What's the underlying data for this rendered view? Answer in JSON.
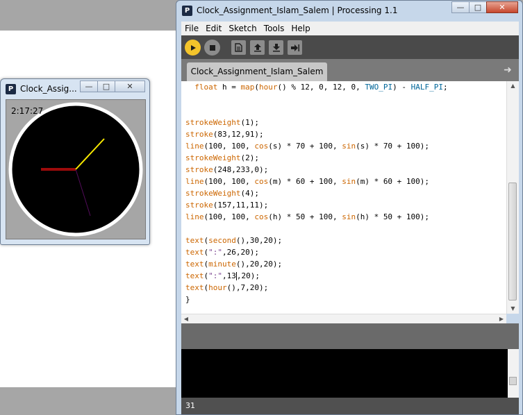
{
  "sketch_window": {
    "title": "Clock_Assig...",
    "time_text": "2:17:27",
    "logo": "P",
    "buttons": [
      "minimize",
      "maximize",
      "close"
    ]
  },
  "clock": {
    "colors": {
      "background": "#a6a6a6",
      "face": "#000000",
      "rim": "#ffffff",
      "second_hand": "#530c5b",
      "minute_hand": "#f8e900",
      "hour_hand": "#9d0b0b"
    }
  },
  "ide": {
    "title": "Clock_Assignment_Islam_Salem | Processing 1.1",
    "logo": "P",
    "menu": [
      "File",
      "Edit",
      "Sketch",
      "Tools",
      "Help"
    ],
    "toolbar": {
      "buttons": [
        "run-icon",
        "stop-icon",
        "new-icon",
        "open-icon",
        "save-icon",
        "export-icon"
      ],
      "run_color": "#f3c42b"
    },
    "tab_label": "Clock_Assignment_Islam_Salem",
    "status_line": "31"
  },
  "code": [
    {
      "segs": [
        {
          "t": "  "
        },
        {
          "t": "float",
          "c": "kw"
        },
        {
          "t": " h = "
        },
        {
          "t": "map",
          "c": "kw"
        },
        {
          "t": "("
        },
        {
          "t": "hour",
          "c": "kw"
        },
        {
          "t": "() % 12, 0, 12, 0, "
        },
        {
          "t": "TWO_PI",
          "c": "const"
        },
        {
          "t": ") - "
        },
        {
          "t": "HALF_PI",
          "c": "const"
        },
        {
          "t": ";"
        }
      ]
    },
    {
      "segs": []
    },
    {
      "segs": []
    },
    {
      "segs": [
        {
          "t": "strokeWeight",
          "c": "kw"
        },
        {
          "t": "(1);"
        }
      ]
    },
    {
      "segs": [
        {
          "t": "stroke",
          "c": "kw"
        },
        {
          "t": "(83,12,91);"
        }
      ]
    },
    {
      "segs": [
        {
          "t": "line",
          "c": "kw"
        },
        {
          "t": "(100, 100, "
        },
        {
          "t": "cos",
          "c": "kw"
        },
        {
          "t": "(s) * 70 + 100, "
        },
        {
          "t": "sin",
          "c": "kw"
        },
        {
          "t": "(s) * 70 + 100);"
        }
      ]
    },
    {
      "segs": [
        {
          "t": "strokeWeight",
          "c": "kw"
        },
        {
          "t": "(2);"
        }
      ]
    },
    {
      "segs": [
        {
          "t": "stroke",
          "c": "kw"
        },
        {
          "t": "(248,233,0);"
        }
      ]
    },
    {
      "segs": [
        {
          "t": "line",
          "c": "kw"
        },
        {
          "t": "(100, 100, "
        },
        {
          "t": "cos",
          "c": "kw"
        },
        {
          "t": "(m) * 60 + 100, "
        },
        {
          "t": "sin",
          "c": "kw"
        },
        {
          "t": "(m) * 60 + 100);"
        }
      ]
    },
    {
      "segs": [
        {
          "t": "strokeWeight",
          "c": "kw"
        },
        {
          "t": "(4);"
        }
      ]
    },
    {
      "segs": [
        {
          "t": "stroke",
          "c": "kw"
        },
        {
          "t": "(157,11,11);"
        }
      ]
    },
    {
      "segs": [
        {
          "t": "line",
          "c": "kw"
        },
        {
          "t": "(100, 100, "
        },
        {
          "t": "cos",
          "c": "kw"
        },
        {
          "t": "(h) * 50 + 100, "
        },
        {
          "t": "sin",
          "c": "kw"
        },
        {
          "t": "(h) * 50 + 100);"
        }
      ]
    },
    {
      "segs": []
    },
    {
      "segs": [
        {
          "t": "text",
          "c": "kw"
        },
        {
          "t": "("
        },
        {
          "t": "second",
          "c": "kw"
        },
        {
          "t": "(),30,20);"
        }
      ]
    },
    {
      "segs": [
        {
          "t": "text",
          "c": "kw"
        },
        {
          "t": "("
        },
        {
          "t": "\":\"",
          "c": "str"
        },
        {
          "t": ",26,20);"
        }
      ]
    },
    {
      "segs": [
        {
          "t": "text",
          "c": "kw"
        },
        {
          "t": "("
        },
        {
          "t": "minute",
          "c": "kw"
        },
        {
          "t": "(),20,20);"
        }
      ]
    },
    {
      "segs": [
        {
          "t": "text",
          "c": "kw"
        },
        {
          "t": "("
        },
        {
          "t": "\":\"",
          "c": "str"
        },
        {
          "t": ",13"
        },
        {
          "caret": true
        },
        {
          "t": ",20);"
        }
      ]
    },
    {
      "segs": [
        {
          "t": "text",
          "c": "kw"
        },
        {
          "t": "("
        },
        {
          "t": "hour",
          "c": "kw"
        },
        {
          "t": "(),7,20);"
        }
      ]
    },
    {
      "segs": [
        {
          "t": "}"
        }
      ]
    }
  ]
}
